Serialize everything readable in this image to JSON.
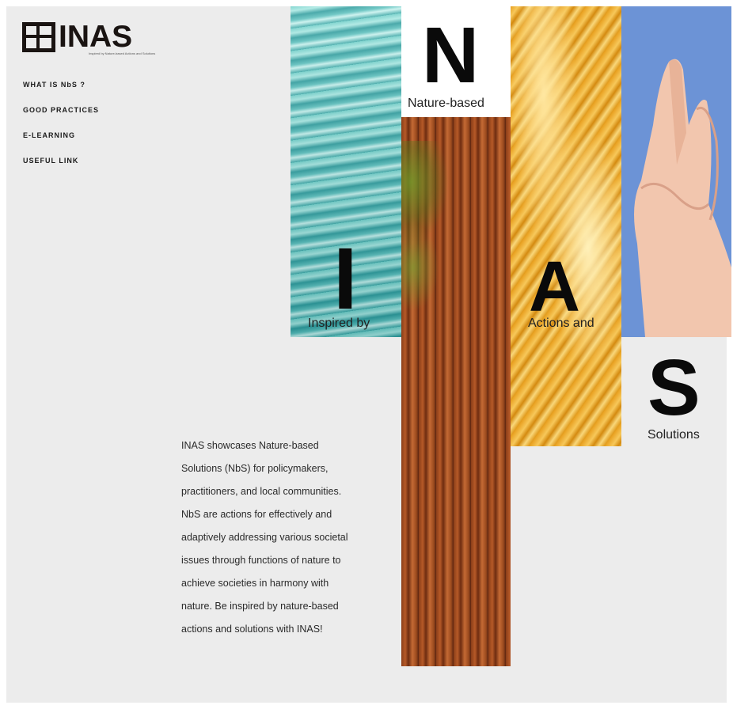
{
  "logo": {
    "icon": "inas-grid-logo-icon",
    "text": "INAS",
    "tagline": "Inspired by Nature-based Actions and Solutions"
  },
  "nav": {
    "items": [
      "WHAT IS NbS ?",
      "GOOD PRACTICES",
      "E-LEARNING",
      "USEFUL LINK"
    ]
  },
  "hero": {
    "letters": [
      {
        "letter": "I",
        "word": "Inspired by"
      },
      {
        "letter": "N",
        "word": "Nature-based"
      },
      {
        "letter": "A",
        "word": "Actions and"
      },
      {
        "letter": "S",
        "word": "Solutions"
      }
    ],
    "images": [
      "water-image",
      "forest-trunk-image",
      "wheat-image",
      "hands-image"
    ]
  },
  "description": "INAS showcases Nature-based Solutions (NbS) for policymakers, practitioners, and local communities. NbS are actions for effectively and adaptively addressing various societal issues through functions of nature to achieve societies in harmony with nature. Be inspired by nature-based actions and solutions with INAS!",
  "colors": {
    "background": "#ececec",
    "text": "#0a0a0a",
    "sky": "#6c93d6"
  }
}
